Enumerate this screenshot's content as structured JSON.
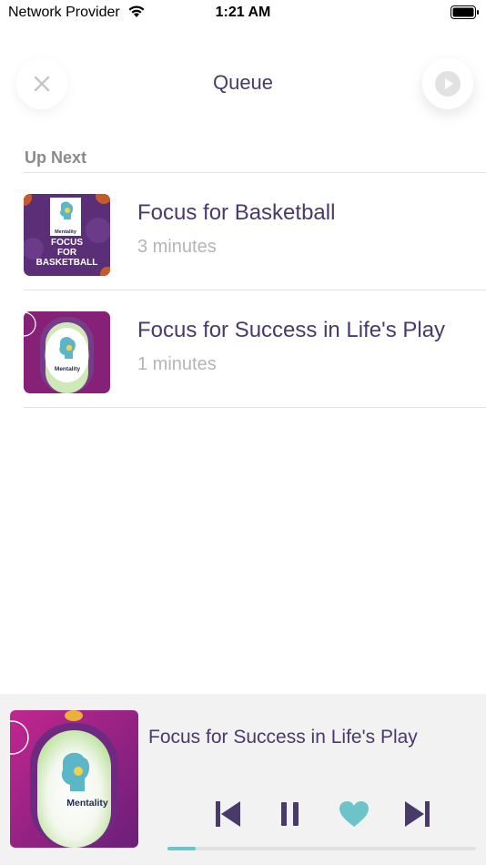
{
  "status_bar": {
    "carrier": "Network Provider",
    "time": "1:21 AM"
  },
  "header": {
    "title": "Queue",
    "close_icon": "close-icon",
    "play_icon": "play-icon"
  },
  "section": {
    "label": "Up Next"
  },
  "queue": [
    {
      "title": "Focus for Basketball",
      "duration": "3 minutes",
      "art": "basketball-artwork"
    },
    {
      "title": "Focus for Success in Life's Play",
      "duration": "1 minutes",
      "art": "life-play-artwork"
    }
  ],
  "artwork": {
    "brand": "Mentality",
    "basketball_line1": "FOCUS",
    "basketball_line2": "FOR",
    "basketball_line3": "BASKETBALL"
  },
  "player": {
    "title": "Focus for Success in Life's Play",
    "progress": 0.09,
    "controls": [
      "previous-icon",
      "pause-icon",
      "heart-icon",
      "next-icon"
    ]
  },
  "colors": {
    "accent_purple": "#4a3a6b",
    "accent_teal": "#6cc4c8",
    "muted_gray": "#b5b5b5"
  }
}
